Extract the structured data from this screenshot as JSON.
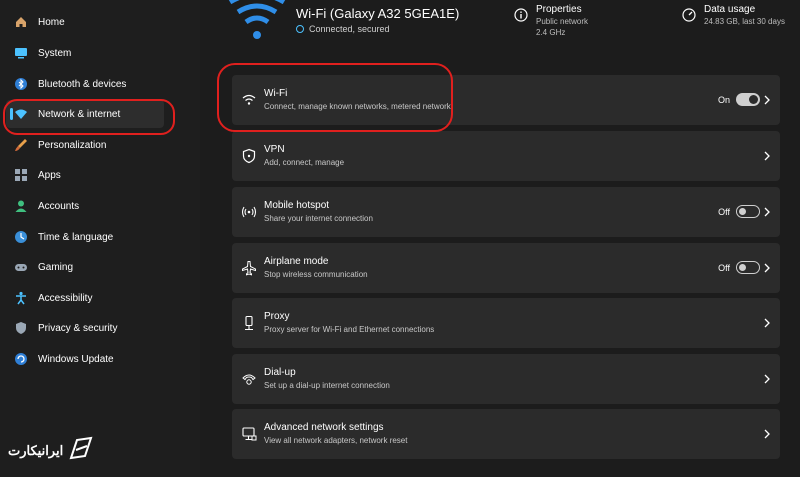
{
  "sidebar": {
    "items": [
      {
        "label": "Home",
        "icon": "home-icon"
      },
      {
        "label": "System",
        "icon": "system-icon"
      },
      {
        "label": "Bluetooth & devices",
        "icon": "bluetooth-icon"
      },
      {
        "label": "Network & internet",
        "icon": "network-icon",
        "active": true
      },
      {
        "label": "Personalization",
        "icon": "brush-icon"
      },
      {
        "label": "Apps",
        "icon": "apps-icon"
      },
      {
        "label": "Accounts",
        "icon": "account-icon"
      },
      {
        "label": "Time & language",
        "icon": "globe-clock-icon"
      },
      {
        "label": "Gaming",
        "icon": "gamepad-icon"
      },
      {
        "label": "Accessibility",
        "icon": "accessibility-icon"
      },
      {
        "label": "Privacy & security",
        "icon": "shield-icon"
      },
      {
        "label": "Windows Update",
        "icon": "update-icon"
      }
    ]
  },
  "header": {
    "title": "Wi-Fi (Galaxy A32 5GEA1E)",
    "status": "Connected, secured",
    "properties": {
      "title": "Properties",
      "line1": "Public network",
      "line2": "2.4 GHz"
    },
    "data_usage": {
      "title": "Data usage",
      "line1": "24.83 GB, last 30 days"
    }
  },
  "settings": {
    "wifi": {
      "title": "Wi-Fi",
      "subtitle": "Connect, manage known networks, metered network",
      "state": "On",
      "icon": "wifi-icon"
    },
    "vpn": {
      "title": "VPN",
      "subtitle": "Add, connect, manage",
      "icon": "vpn-shield-icon"
    },
    "hotspot": {
      "title": "Mobile hotspot",
      "subtitle": "Share your internet connection",
      "state": "Off",
      "icon": "hotspot-icon"
    },
    "airplane": {
      "title": "Airplane mode",
      "subtitle": "Stop wireless communication",
      "state": "Off",
      "icon": "airplane-icon"
    },
    "proxy": {
      "title": "Proxy",
      "subtitle": "Proxy server for Wi-Fi and Ethernet connections",
      "icon": "proxy-icon"
    },
    "dialup": {
      "title": "Dial-up",
      "subtitle": "Set up a dial-up internet connection",
      "icon": "dialup-icon"
    },
    "advanced": {
      "title": "Advanced network settings",
      "subtitle": "View all network adapters, network reset",
      "icon": "monitor-network-icon"
    }
  },
  "logo": {
    "text": "ایرانیکارت"
  },
  "colors": {
    "accent": "#4cc2ff",
    "annotation": "#e0201e",
    "card": "#2b2b2b",
    "background": "#1c1c1c"
  }
}
